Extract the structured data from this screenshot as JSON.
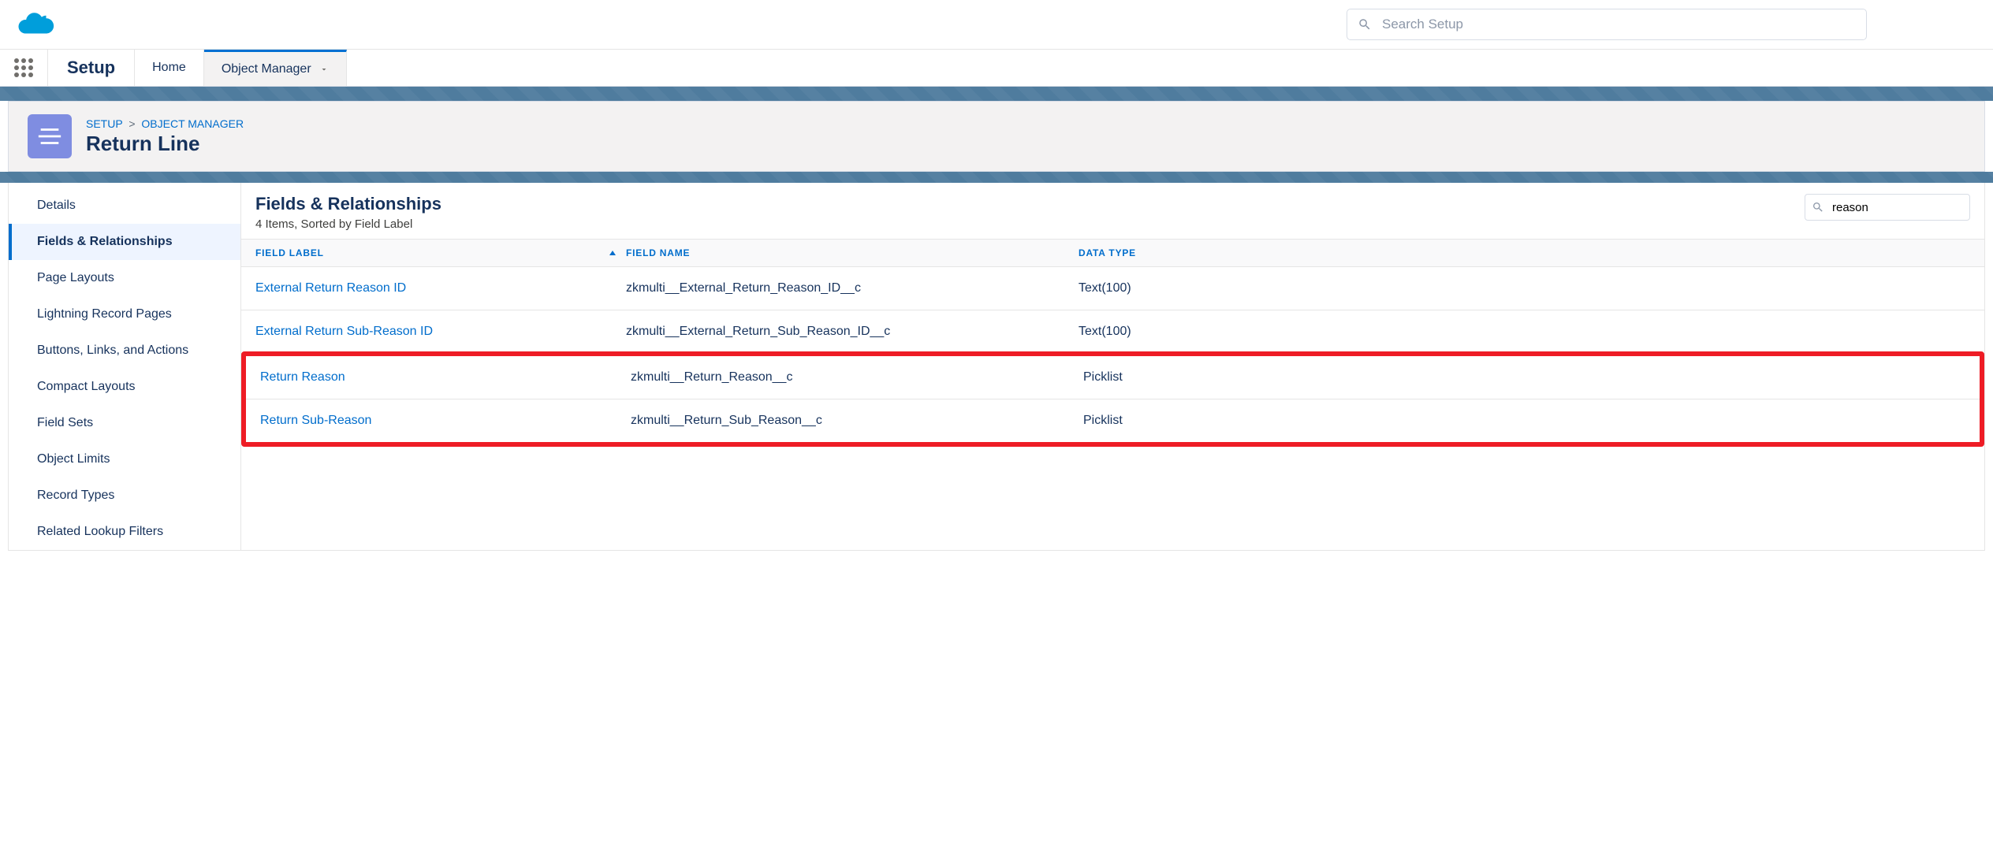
{
  "global": {
    "searchPlaceholder": "Search Setup",
    "appName": "Setup"
  },
  "nav": {
    "home": "Home",
    "objectManager": "Object Manager"
  },
  "breadcrumb": {
    "setup": "SETUP",
    "objectManager": "OBJECT MANAGER"
  },
  "pageTitle": "Return Line",
  "sidebar": {
    "items": [
      "Details",
      "Fields & Relationships",
      "Page Layouts",
      "Lightning Record Pages",
      "Buttons, Links, and Actions",
      "Compact Layouts",
      "Field Sets",
      "Object Limits",
      "Record Types",
      "Related Lookup Filters"
    ],
    "activeIndex": 1
  },
  "main": {
    "title": "Fields & Relationships",
    "subtitle": "4 Items, Sorted by Field Label",
    "searchValue": "reason"
  },
  "table": {
    "headers": {
      "label": "FIELD LABEL",
      "name": "FIELD NAME",
      "type": "DATA TYPE"
    },
    "rows": [
      {
        "label": "External Return Reason ID",
        "name": "zkmulti__External_Return_Reason_ID__c",
        "type": "Text(100)",
        "highlighted": false
      },
      {
        "label": "External Return Sub-Reason ID",
        "name": "zkmulti__External_Return_Sub_Reason_ID__c",
        "type": "Text(100)",
        "highlighted": false
      },
      {
        "label": "Return Reason",
        "name": "zkmulti__Return_Reason__c",
        "type": "Picklist",
        "highlighted": true
      },
      {
        "label": "Return Sub-Reason",
        "name": "zkmulti__Return_Sub_Reason__c",
        "type": "Picklist",
        "highlighted": true
      }
    ]
  }
}
